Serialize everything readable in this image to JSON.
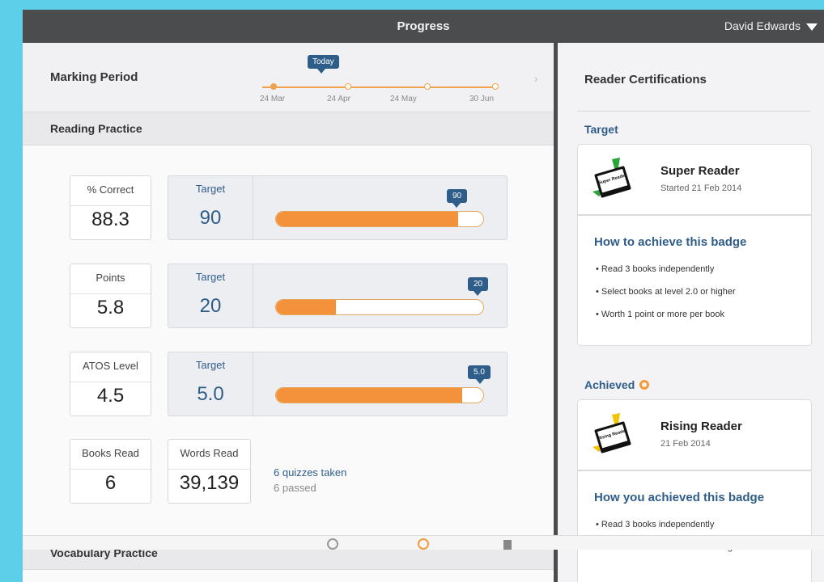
{
  "header": {
    "title": "Progress",
    "user": "David Edwards"
  },
  "marking_period": {
    "label": "Marking Period",
    "today_label": "Today",
    "dates": [
      "24 Mar",
      "24 Apr",
      "24 May",
      "30 Jun"
    ]
  },
  "reading_practice": {
    "title": "Reading Practice",
    "metrics": [
      {
        "label": "% Correct",
        "value": "88.3",
        "target_label": "Target",
        "target": "90",
        "flag": "90",
        "progress": 0.88
      },
      {
        "label": "Points",
        "value": "5.8",
        "target_label": "Target",
        "target": "20",
        "flag": "20",
        "progress": 0.29
      },
      {
        "label": "ATOS Level",
        "value": "4.5",
        "target_label": "Target",
        "target": "5.0",
        "flag": "5.0",
        "progress": 0.9
      }
    ],
    "books_read": {
      "label": "Books Read",
      "value": "6"
    },
    "words_read": {
      "label": "Words Read",
      "value": "39,139"
    },
    "quizzes_taken": "6 quizzes taken",
    "quizzes_passed": "6 passed"
  },
  "vocabulary_practice": {
    "title": "Vocabulary Practice"
  },
  "certifications": {
    "title": "Reader Certifications",
    "target_heading": "Target",
    "target_badge": {
      "name": "Super Reader",
      "badge_text": "Super Reader",
      "date": "Started 21 Feb 2014",
      "how_title": "How to achieve this badge",
      "bullets": [
        "Read 3 books independently",
        "Select books at level 2.0 or higher",
        "Worth 1 point or more per book"
      ],
      "color": "#2aa33a"
    },
    "achieved_heading": "Achieved",
    "achieved_badge": {
      "name": "Rising Reader",
      "badge_text": "Rising Reader",
      "date": "21 Feb 2014",
      "how_title": "How you achieved this badge",
      "bullets": [
        "Read 3 books independently",
        "Selected books at level 1.6 or higher"
      ],
      "color": "#f2c400"
    }
  },
  "colors": {
    "accent": "#2f5d8a",
    "bar": "#f3923a",
    "topbar": "#4b4c4e"
  },
  "bottom_tabs": [
    "search-icon",
    "progress-icon",
    "library-icon"
  ]
}
